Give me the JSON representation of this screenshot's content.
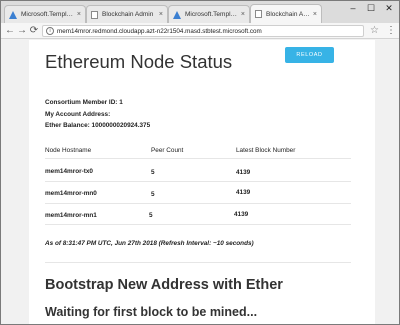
{
  "browser": {
    "tabs": [
      {
        "label": "Microsoft.Template - ",
        "icon": "azure-icon"
      },
      {
        "label": "Blockchain Admin",
        "icon": "page-icon"
      },
      {
        "label": "Microsoft.Template - ",
        "icon": "azure-icon"
      },
      {
        "label": "Blockchain Admin",
        "icon": "page-icon"
      }
    ],
    "tab_close": "×",
    "window_controls": {
      "minimize": "–",
      "maximize": "☐",
      "close": "✕"
    },
    "nav": {
      "back": "←",
      "forward": "→",
      "reload": "⟳"
    },
    "url": "mem14mror.redmond.cloudapp.azt-n22r1504.masd.stbtest.microsoft.com",
    "info": "i",
    "star": "☆",
    "menu": "⋮"
  },
  "page": {
    "title": "Ethereum Node Status",
    "reload_label": "RELOAD",
    "consortium": "Consortium Member ID: 1",
    "account": "My Account Address:",
    "balance": "Ether Balance: 1000000020924.375",
    "table": {
      "headers": [
        "Node Hostname",
        "Peer Count",
        "Latest Block Number"
      ],
      "rows": [
        [
          "mem14mror-tx0",
          "5",
          "4139"
        ],
        [
          "mem14mror-mn0",
          "5",
          "4139"
        ],
        [
          "mem14mror-mn1",
          "5",
          "4139"
        ]
      ]
    },
    "status": "As of 8:31:47 PM UTC, Jun 27th 2018 (Refresh Interval: ~10 seconds)",
    "bootstrap_title": "Bootstrap New Address with Ether",
    "waiting": "Waiting for first block to be mined..."
  },
  "colors": {
    "accent": "#37b3e6",
    "text": "#333333",
    "page_bg": "#f1f1f1"
  }
}
